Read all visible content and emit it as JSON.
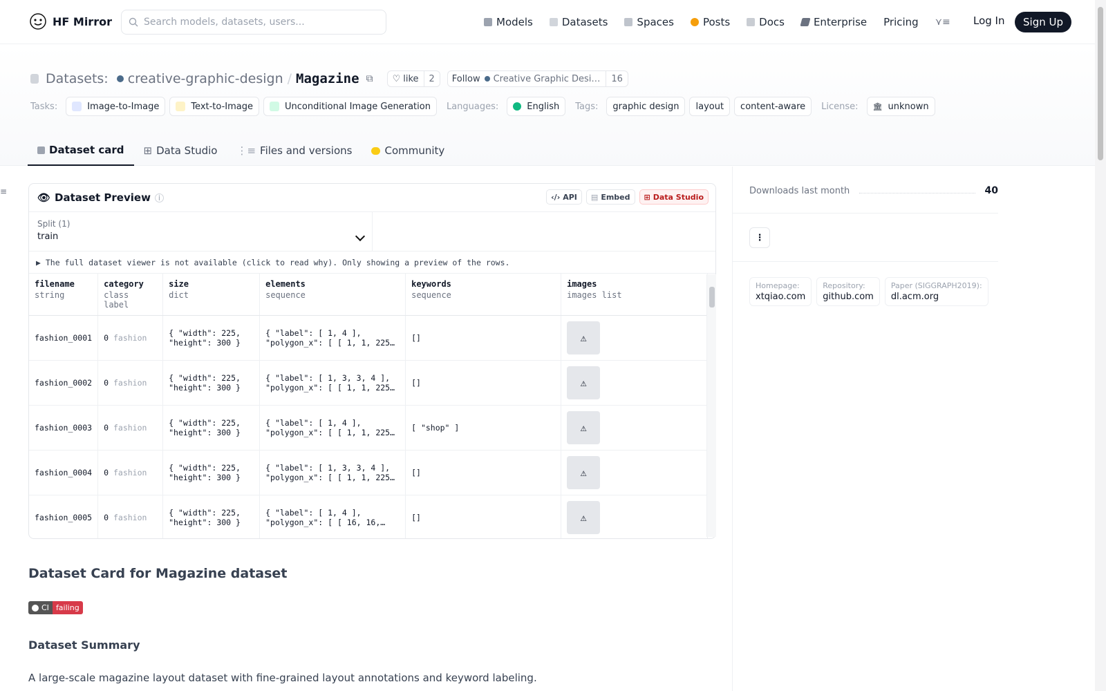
{
  "header": {
    "brand": "HF Mirror",
    "search_placeholder": "Search models, datasets, users...",
    "nav": [
      "Models",
      "Datasets",
      "Spaces",
      "Posts",
      "Docs",
      "Enterprise",
      "Pricing"
    ],
    "login": "Log In",
    "signup": "Sign Up"
  },
  "repo": {
    "kind": "Datasets:",
    "owner": "creative-graphic-design",
    "name": "Magazine",
    "like_label": "like",
    "likes": "2",
    "follow_label": "Follow",
    "follow_org": "Creative Graphic Desi…",
    "followers": "16"
  },
  "tags": {
    "tasks_label": "Tasks:",
    "tasks": [
      "Image-to-Image",
      "Text-to-Image",
      "Unconditional Image Generation"
    ],
    "languages_label": "Languages:",
    "languages": [
      "English"
    ],
    "tags_label": "Tags:",
    "tags": [
      "graphic design",
      "layout",
      "content-aware"
    ],
    "license_label": "License:",
    "license": "unknown"
  },
  "tabs": [
    "Dataset card",
    "Data Studio",
    "Files and versions",
    "Community"
  ],
  "preview": {
    "title": "Dataset Preview",
    "actions": [
      "API",
      "Embed",
      "Data Studio"
    ],
    "split_label": "Split (1)",
    "split_value": "train",
    "notice": "▶ The full dataset viewer is not available (click to read why). Only showing a preview of the rows.",
    "columns": [
      {
        "name": "filename",
        "type": "string"
      },
      {
        "name": "category",
        "type": "class label"
      },
      {
        "name": "size",
        "type": "dict"
      },
      {
        "name": "elements",
        "type": "sequence"
      },
      {
        "name": "keywords",
        "type": "sequence"
      },
      {
        "name": "images",
        "type": "images list"
      }
    ],
    "rows": [
      {
        "filename": "fashion_0001",
        "cat_id": "0",
        "cat": "fashion",
        "size": "{ \"width\": 225,\n\"height\": 300 }",
        "elements": "{ \"label\": [ 1, 4 ],\n\"polygon_x\": [ [ 1, 1, 225…",
        "keywords": "[]"
      },
      {
        "filename": "fashion_0002",
        "cat_id": "0",
        "cat": "fashion",
        "size": "{ \"width\": 225,\n\"height\": 300 }",
        "elements": "{ \"label\": [ 1, 3, 3, 4 ],\n\"polygon_x\": [ [ 1, 1, 225…",
        "keywords": "[]"
      },
      {
        "filename": "fashion_0003",
        "cat_id": "0",
        "cat": "fashion",
        "size": "{ \"width\": 225,\n\"height\": 300 }",
        "elements": "{ \"label\": [ 1, 4 ],\n\"polygon_x\": [ [ 1, 1, 225…",
        "keywords": "[ \"shop\" ]"
      },
      {
        "filename": "fashion_0004",
        "cat_id": "0",
        "cat": "fashion",
        "size": "{ \"width\": 225,\n\"height\": 300 }",
        "elements": "{ \"label\": [ 1, 3, 3, 4 ],\n\"polygon_x\": [ [ 1, 1, 225…",
        "keywords": "[]"
      },
      {
        "filename": "fashion_0005",
        "cat_id": "0",
        "cat": "fashion",
        "size": "{ \"width\": 225,\n\"height\": 300 }",
        "elements": "{ \"label\": [ 1, 4 ],\n\"polygon_x\": [ [ 16, 16,…",
        "keywords": "[]"
      }
    ]
  },
  "card": {
    "heading": "Dataset Card for Magazine dataset",
    "badge_left": "CI",
    "badge_right": "failing",
    "summary_heading": "Dataset Summary",
    "summary": "A large-scale magazine layout dataset with fine-grained layout annotations and keyword labeling."
  },
  "sidebar": {
    "downloads_label": "Downloads last month",
    "downloads": "40",
    "links": [
      {
        "key": "Homepage:",
        "value": "xtqiao.com"
      },
      {
        "key": "Repository:",
        "value": "github.com"
      },
      {
        "key": "Paper (SIGGRAPH2019):",
        "value": "dl.acm.org"
      }
    ]
  }
}
